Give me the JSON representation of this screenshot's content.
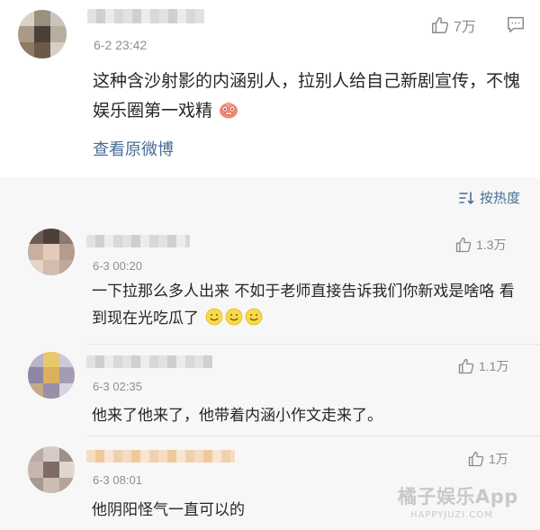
{
  "post": {
    "time": "6-2 23:42",
    "like_count": "7万",
    "content": "这种含沙射影的内涵别人，拉别人给自己新剧宣传，不愧娱乐圈第一戏精",
    "view_original": "查看原微博"
  },
  "sort": {
    "label": "按热度"
  },
  "comments": [
    {
      "time": "6-3 00:20",
      "like_count": "1.3万",
      "text": "一下拉那么多人出来  不如于老师直接告诉我们你新戏是啥咯  看到现在光吃瓜了"
    },
    {
      "time": "6-3 02:35",
      "like_count": "1.1万",
      "text": "他来了他来了，他带着内涵小作文走来了。"
    },
    {
      "time": "6-3 08:01",
      "like_count": "1万",
      "text": "他阴阳怪气一直可以的"
    }
  ],
  "watermark": {
    "main": "橘子娱乐App",
    "sub": "HAPPYJUZI.COM"
  },
  "icons": {
    "like": "thumbs-up-icon",
    "comment": "comment-bubble-icon",
    "sort": "sort-icon",
    "emoji_post": "red-face-emoji",
    "emoji_comment": "smile-emoji"
  },
  "colors": {
    "link": "#4a6d95",
    "meta": "#8f8f8f",
    "comments_bg": "#f7f7f7"
  }
}
